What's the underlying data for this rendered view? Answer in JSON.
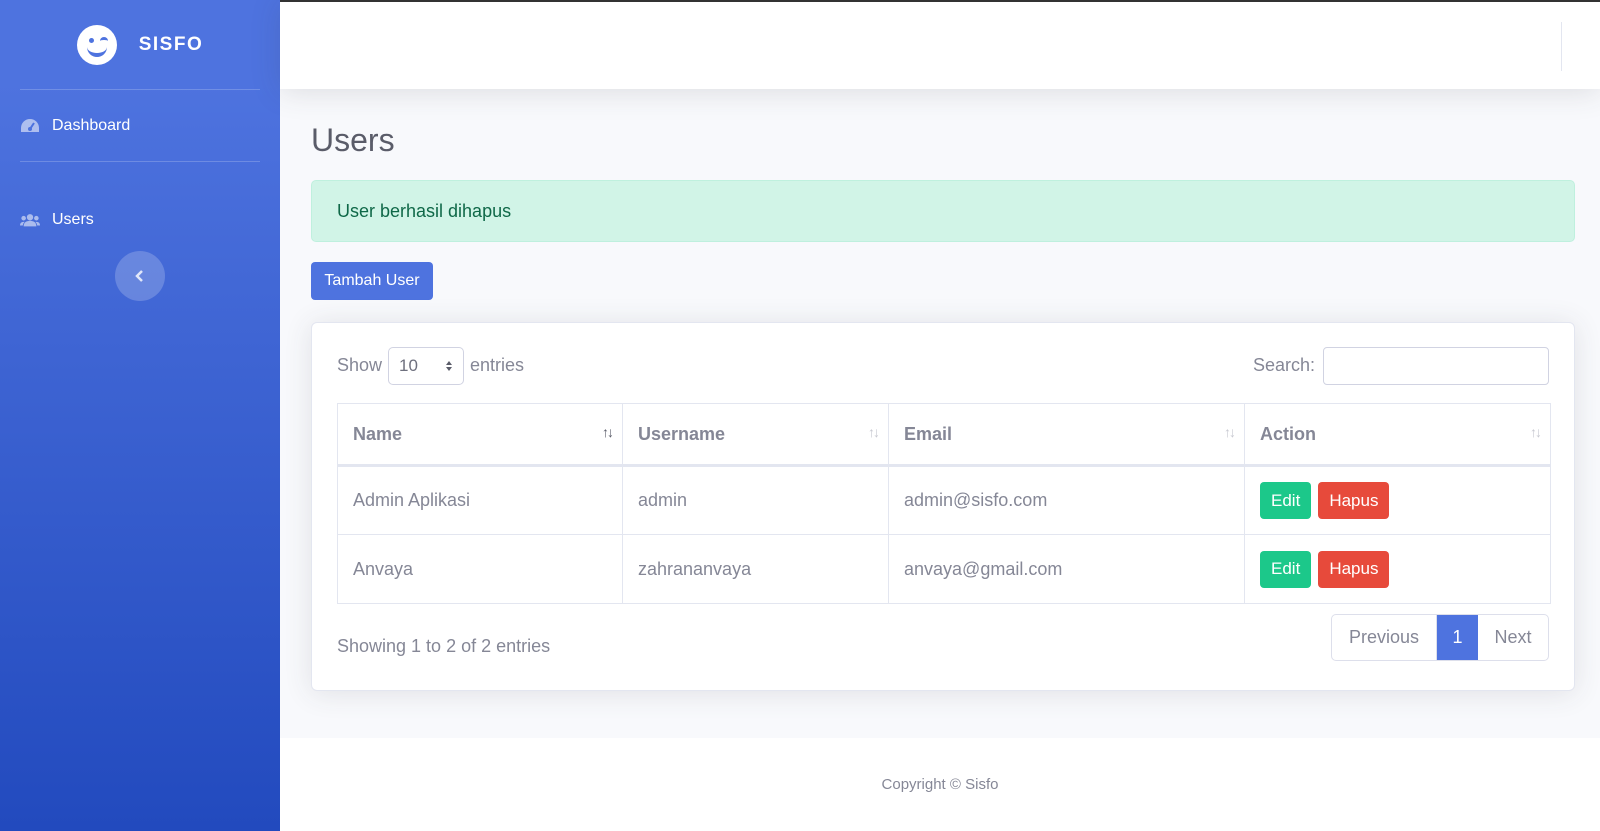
{
  "sidebar": {
    "brand": "SISFO",
    "items": [
      {
        "label": "Dashboard",
        "icon": "tachometer-icon"
      },
      {
        "label": "Users",
        "icon": "users-icon"
      }
    ]
  },
  "page": {
    "title": "Users",
    "alert": "User berhasil dihapus",
    "add_button": "Tambah User"
  },
  "datatable": {
    "show_label": "Show",
    "entries_label": "entries",
    "page_length": "10",
    "search_label": "Search:",
    "search_value": "",
    "columns": [
      "Name",
      "Username",
      "Email",
      "Action"
    ],
    "rows": [
      {
        "name": "Admin Aplikasi",
        "username": "admin",
        "email": "admin@sisfo.com"
      },
      {
        "name": "Anvaya",
        "username": "zahrananvaya",
        "email": "anvaya@gmail.com"
      }
    ],
    "edit_label": "Edit",
    "delete_label": "Hapus",
    "info": "Showing 1 to 2 of 2 entries",
    "pagination": {
      "previous": "Previous",
      "current": "1",
      "next": "Next"
    }
  },
  "footer": {
    "copyright": "Copyright © Sisfo"
  },
  "colors": {
    "primary": "#4e73df",
    "success": "#1cc88a",
    "danger": "#e74a3b",
    "alert_bg": "#d1f4e7"
  }
}
